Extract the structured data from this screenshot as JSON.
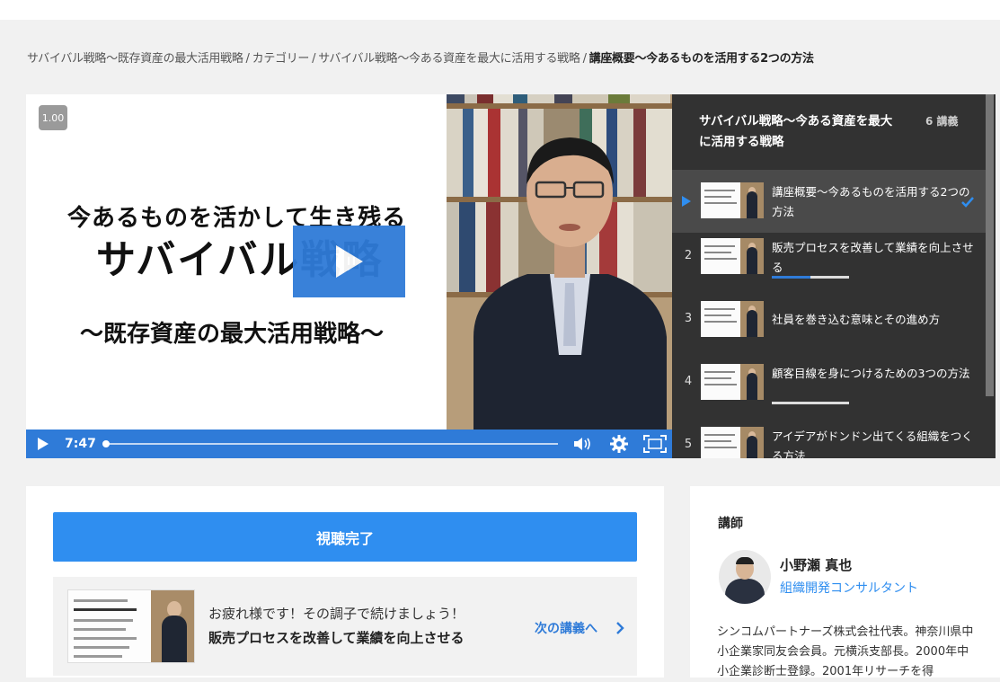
{
  "breadcrumb": {
    "items": [
      "サバイバル戦略～既存資産の最大活用戦略",
      "カテゴリー",
      "サバイバル戦略～今ある資産を最大に活用する戦略"
    ],
    "separator": "/",
    "current": "講座概要～今あるものを活用する2つの方法"
  },
  "player": {
    "speed": "1.00",
    "slide_lines": [
      "今あるものを活かして生き残る",
      "サバイバル戦略",
      "～既存資産の最大活用戦略～"
    ],
    "time": "7:47",
    "progress": 0,
    "icons": [
      "play-icon",
      "volume-icon",
      "gear-icon",
      "fullscreen-icon"
    ],
    "accent_color": "#2f7bd8"
  },
  "playlist": {
    "title": "サバイバル戦略～今ある資産を最大に活用する戦略",
    "count": "6 講義",
    "items": [
      {
        "num": "",
        "label": "講座概要～今あるものを活用する2つの方法",
        "active": true,
        "completed": true,
        "progress": null
      },
      {
        "num": "2",
        "label": "販売プロセスを改善して業績を向上させる",
        "active": false,
        "completed": false,
        "progress": 0.5
      },
      {
        "num": "3",
        "label": "社員を巻き込む意味とその進め方",
        "active": false,
        "completed": false,
        "progress": null
      },
      {
        "num": "4",
        "label": "顧客目線を身につけるための3つの方法",
        "active": false,
        "completed": false,
        "progress": 0
      },
      {
        "num": "5",
        "label": "アイデアがドンドン出てくる組織をつくる方法",
        "active": false,
        "completed": false,
        "progress": null
      }
    ]
  },
  "completion": {
    "button_label": "視聴完了",
    "message": "お疲れ様です！その調子で続けましょう！",
    "next_title": "販売プロセスを改善して業績を向上させる",
    "next_link": "次の講義へ"
  },
  "instructor": {
    "heading": "講師",
    "name": "小野瀬 真也",
    "role": "組織開発コンサルタント",
    "bio": "シンコムパートナーズ株式会社代表。神奈川県中小企業家同友会会員。元横浜支部長。2000年中小企業診断士登録。2001年リサーチを得"
  }
}
